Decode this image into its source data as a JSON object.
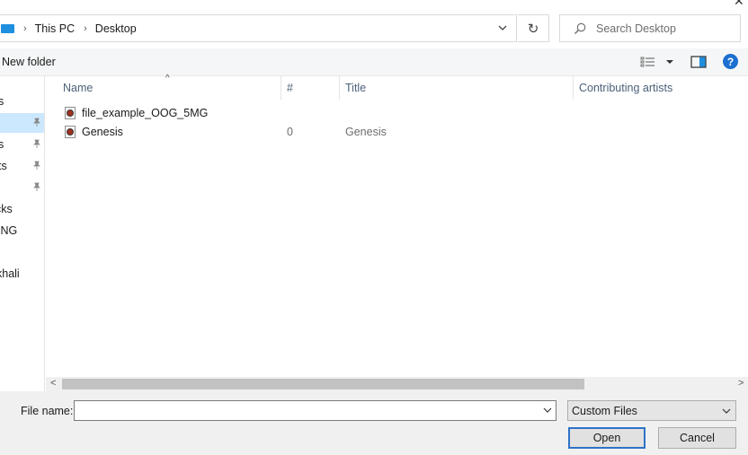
{
  "address": {
    "breadcrumbs": [
      "This PC",
      "Desktop"
    ],
    "search_placeholder": "Search Desktop"
  },
  "toolbar": {
    "new_folder": "New folder",
    "help_label": "?"
  },
  "nav": {
    "items": [
      {
        "label": "s",
        "pinned": false,
        "selected": false
      },
      {
        "label": "",
        "pinned": true,
        "selected": true
      },
      {
        "label": "s",
        "pinned": true,
        "selected": false
      },
      {
        "label": "ts",
        "pinned": true,
        "selected": false
      },
      {
        "label": "",
        "pinned": true,
        "selected": false
      },
      {
        "label": "cks",
        "pinned": false,
        "selected": false
      },
      {
        "label": "ING",
        "pinned": false,
        "selected": false
      },
      {
        "label": "",
        "pinned": false,
        "selected": false
      },
      {
        "label": "khali",
        "pinned": false,
        "selected": false
      }
    ]
  },
  "columns": {
    "name": "Name",
    "number": "#",
    "title": "Title",
    "artists": "Contributing artists"
  },
  "files": [
    {
      "name": "file_example_OOG_5MG",
      "number": "",
      "title": ""
    },
    {
      "name": "Genesis",
      "number": "0",
      "title": "Genesis"
    }
  ],
  "footer": {
    "file_name_label": "File name:",
    "file_name_value": "",
    "file_type": "Custom Files",
    "open": "Open",
    "cancel": "Cancel"
  }
}
